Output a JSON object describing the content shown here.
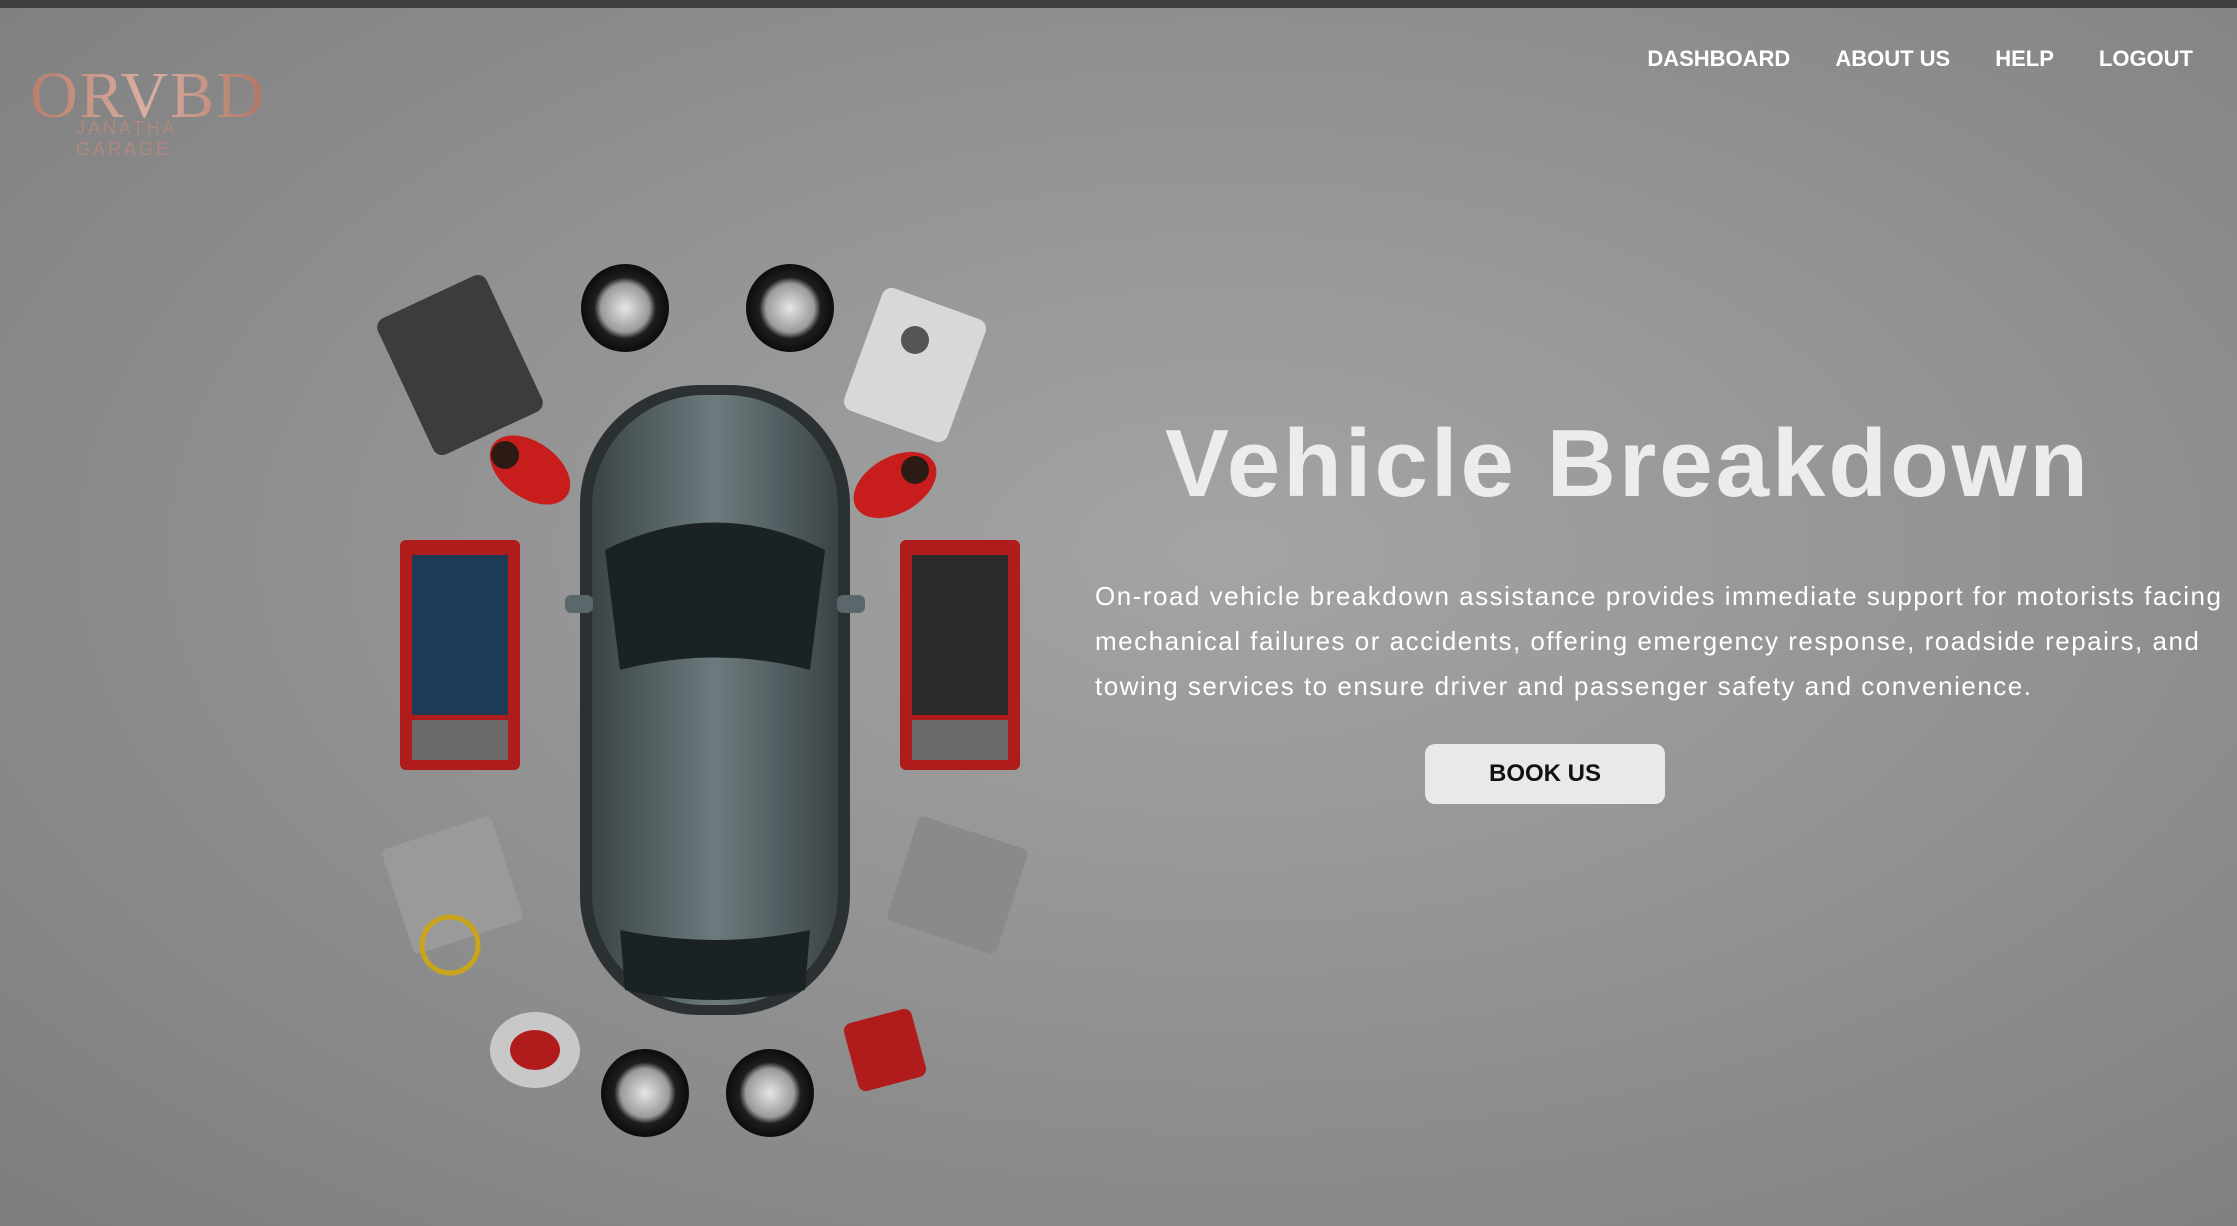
{
  "logo": {
    "title": "ORVBD",
    "subtitle": "JANATHA GARAGE"
  },
  "nav": {
    "items": [
      {
        "label": "DASHBOARD"
      },
      {
        "label": "ABOUT US"
      },
      {
        "label": "HELP"
      },
      {
        "label": "LOGOUT"
      }
    ]
  },
  "hero": {
    "title": "Vehicle Breakdown",
    "description": "On-road vehicle breakdown assistance provides immediate support for motorists facing mechanical failures or accidents, offering emergency response, roadside repairs, and towing services to ensure driver and passenger safety and convenience.",
    "button_label": "BOOK US"
  },
  "image": {
    "icon": "garage-car-top-view-illustration"
  },
  "colors": {
    "nav_text": "#ffffff",
    "logo": "#c99a8a",
    "button_bg": "#e9e9e9",
    "background": "#939393"
  }
}
